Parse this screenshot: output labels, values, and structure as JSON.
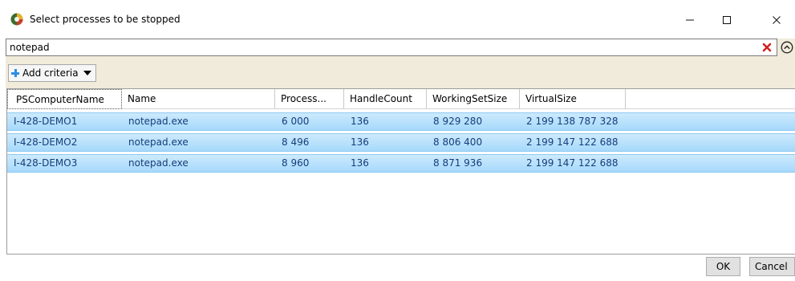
{
  "window": {
    "title": "Select processes to be stopped",
    "controls": {
      "minimize": "—",
      "maximize": "☐",
      "close": "✕"
    }
  },
  "search": {
    "value": "notepad",
    "clear_icon": "red-x-icon",
    "collapse_icon": "chevron-up-circle-icon"
  },
  "criteria": {
    "add_label": "Add criteria"
  },
  "grid": {
    "columns": [
      "PSComputerName",
      "Name",
      "Process...",
      "HandleCount",
      "WorkingSetSize",
      "VirtualSize"
    ],
    "rows": [
      [
        "I-428-DEMO1",
        "notepad.exe",
        "6 000",
        "136",
        "8 929 280",
        "2 199 138 787 328"
      ],
      [
        "I-428-DEMO2",
        "notepad.exe",
        "8 496",
        "136",
        "8 806 400",
        "2 199 147 122 688"
      ],
      [
        "I-428-DEMO3",
        "notepad.exe",
        "8 960",
        "136",
        "8 871 936",
        "2 199 147 122 688"
      ]
    ]
  },
  "buttons": {
    "ok": "OK",
    "cancel": "Cancel"
  },
  "colors": {
    "accent_bar": "#f1ebdb",
    "row_selected": "#a6d9fb",
    "row_text": "#143d7a",
    "clear_red": "#d42020"
  }
}
